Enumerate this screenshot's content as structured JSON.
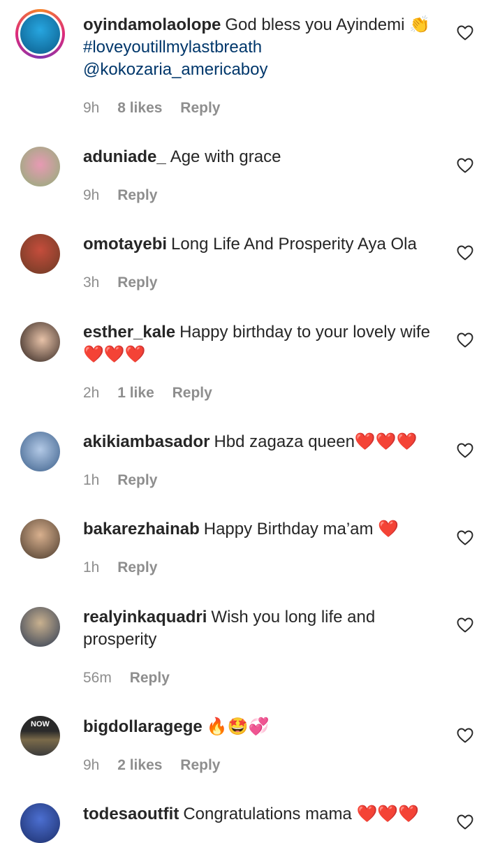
{
  "comments": [
    {
      "username": "oyindamolaolope",
      "text": "God bless you Ayindemi 👏",
      "hashtag": "#loveyoutillmylastbreath",
      "mention": "@kokozaria_americaboy",
      "time": "9h",
      "likes": "8 likes",
      "reply": "Reply",
      "avatar_color": "#1b8fc9"
    },
    {
      "username": "aduniade_",
      "text": "Age with grace",
      "time": "9h",
      "reply": "Reply",
      "avatar_color": "#d36b8b"
    },
    {
      "username": "omotayebi",
      "text": "Long Life And Prosperity Aya Ola",
      "time": "3h",
      "reply": "Reply",
      "avatar_color": "#8a4a2e"
    },
    {
      "username": "esther_kale",
      "text": "Happy birthday to your lovely wife❤️❤️❤️",
      "time": "2h",
      "likes": "1 like",
      "reply": "Reply",
      "avatar_color": "#3a2a24"
    },
    {
      "username": "akikiambasador",
      "text": "Hbd zagaza queen❤️❤️❤️",
      "time": "1h",
      "reply": "Reply",
      "avatar_color": "#7c9fc7"
    },
    {
      "username": "bakarezhainab",
      "text": "Happy Birthday ma’am ❤️",
      "time": "1h",
      "reply": "Reply",
      "avatar_color": "#5a4636"
    },
    {
      "username": "realyinkaquadri",
      "text": "Wish you long life and prosperity",
      "time": "56m",
      "reply": "Reply",
      "avatar_color": "#40516b"
    },
    {
      "username": "bigdollaragege",
      "text": "🔥🤩💞",
      "time": "9h",
      "likes": "2 likes",
      "reply": "Reply",
      "avatar_color": "#3b3b3b",
      "avatar_label": "NOW"
    },
    {
      "username": "todesaoutfit",
      "text": "Congratulations mama ❤️❤️❤️",
      "avatar_color": "#2f4f9f"
    }
  ]
}
